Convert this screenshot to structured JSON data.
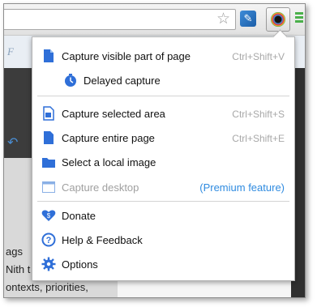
{
  "page": {
    "partial_title_letter": "F",
    "text_lines": [
      "ags",
      "Nith t",
      "ontexts, priorities,"
    ]
  },
  "menu": {
    "items": [
      {
        "label": "Capture visible part of page",
        "shortcut": "Ctrl+Shift+V",
        "icon": "page-visible-icon"
      },
      {
        "label": "Delayed capture",
        "shortcut": "",
        "icon": "timer-icon"
      },
      {
        "label": "Capture selected area",
        "shortcut": "Ctrl+Shift+S",
        "icon": "selected-area-icon"
      },
      {
        "label": "Capture entire page",
        "shortcut": "Ctrl+Shift+E",
        "icon": "entire-page-icon"
      },
      {
        "label": "Select a local image",
        "shortcut": "",
        "icon": "folder-icon"
      },
      {
        "label": "Capture desktop",
        "note": "(Premium feature)",
        "icon": "desktop-icon",
        "disabled": true
      },
      {
        "label": "Donate",
        "icon": "donate-heart-icon"
      },
      {
        "label": "Help & Feedback",
        "icon": "help-icon"
      },
      {
        "label": "Options",
        "icon": "gear-icon"
      }
    ]
  },
  "colors": {
    "accent_blue": "#2f6fd8",
    "premium_link": "#2f8be0",
    "shortcut_gray": "#a8a8a8",
    "disabled_gray": "#a0a0a0"
  }
}
